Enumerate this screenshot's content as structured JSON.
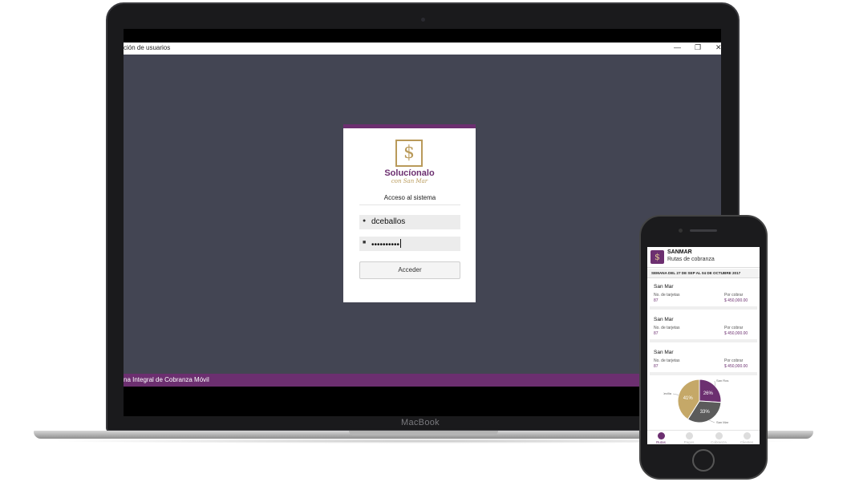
{
  "desktop_app": {
    "window_title": "ción de usuarios",
    "controls": {
      "minimize": "—",
      "maximize": "❐",
      "close": "✕"
    },
    "login": {
      "brand_name": "Solucíonalo",
      "brand_tagline": "con San Mar",
      "title": "Acceso al sistema",
      "username_value": "dceballos",
      "password_mask": "••••••••••",
      "submit_label": "Acceder"
    },
    "statusbar_text": "na Integral de Cobranza Móvil"
  },
  "device_label": "MacBook",
  "mobile_app": {
    "title": "SANMAR",
    "subtitle": "Rutas de cobranza",
    "week": "SEMANA DEL 27 DE SEP AL 04 DE OCTUBRE 2017",
    "routes": [
      {
        "name": "San Mar",
        "cards_label": "No. de tarjetas",
        "cards_value": "87",
        "pending_label": "Por cobrar",
        "pending_value": "$ 450,000.00"
      },
      {
        "name": "San Mar",
        "cards_label": "No. de tarjetas",
        "cards_value": "87",
        "pending_label": "Por cobrar",
        "pending_value": "$ 450,000.00"
      },
      {
        "name": "San Mar",
        "cards_label": "No. de tarjetas",
        "cards_value": "87",
        "pending_label": "Por cobrar",
        "pending_value": "$ 450,000.00"
      }
    ],
    "chart_data": {
      "type": "pie",
      "categories": [
        "San Ros",
        "San Mar",
        "Cecilia"
      ],
      "values": [
        26,
        33,
        41
      ],
      "labels": [
        "26%",
        "33%",
        "41%"
      ],
      "colors": [
        "#6c2f70",
        "#5b5b5b",
        "#c5a868"
      ]
    },
    "tabs": [
      {
        "label": "Rutas",
        "active": true
      },
      {
        "label": "Pagos",
        "active": false
      },
      {
        "label": "Cobranza",
        "active": false
      },
      {
        "label": "Clientes",
        "active": false
      }
    ]
  }
}
